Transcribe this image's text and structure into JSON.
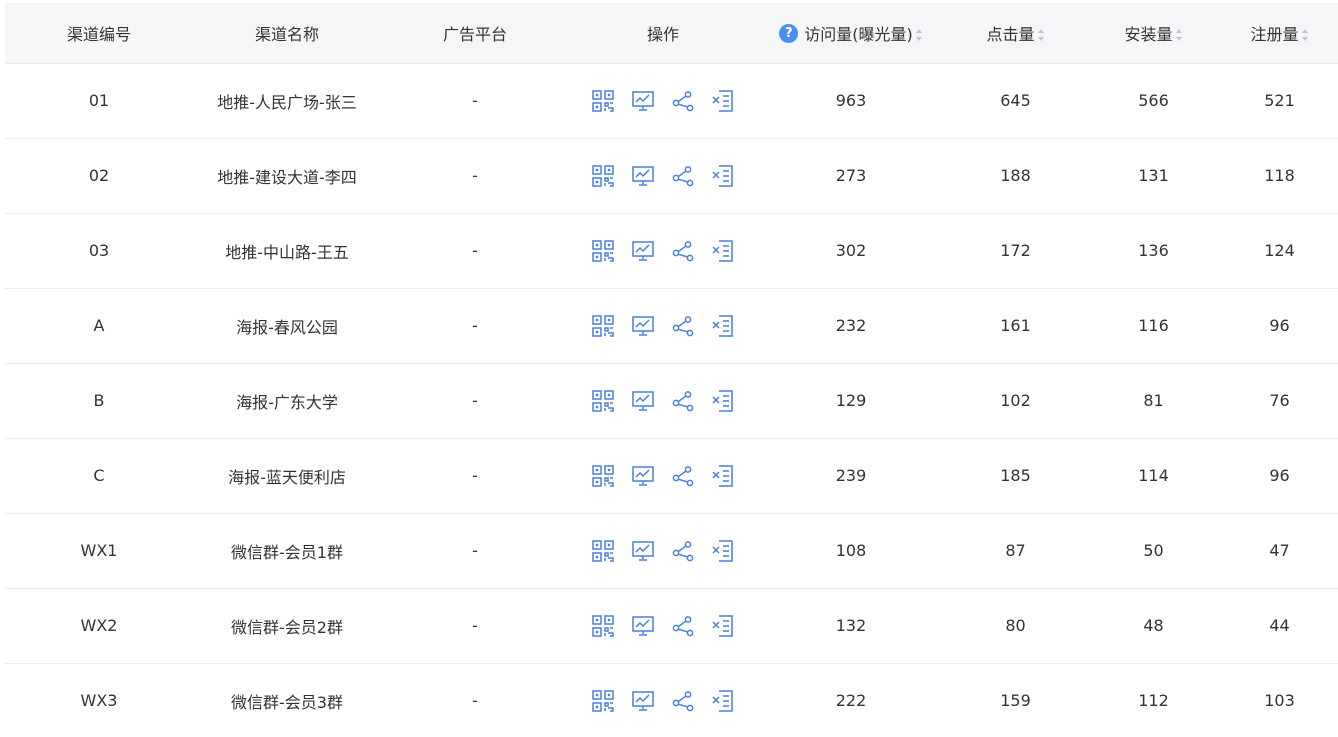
{
  "table": {
    "columns": [
      {
        "key": "code",
        "label": "渠道编号",
        "sortable": false,
        "help": false
      },
      {
        "key": "name",
        "label": "渠道名称",
        "sortable": false,
        "help": false
      },
      {
        "key": "platform",
        "label": "广告平台",
        "sortable": false,
        "help": false
      },
      {
        "key": "ops",
        "label": "操作",
        "sortable": false,
        "help": false
      },
      {
        "key": "visits",
        "label": "访问量(曝光量)",
        "sortable": true,
        "help": true
      },
      {
        "key": "clicks",
        "label": "点击量",
        "sortable": true,
        "help": false
      },
      {
        "key": "installs",
        "label": "安装量",
        "sortable": true,
        "help": false
      },
      {
        "key": "registers",
        "label": "注册量",
        "sortable": true,
        "help": false
      }
    ],
    "help_glyph": "?",
    "op_icons": [
      "qrcode-icon",
      "trend-chart-icon",
      "share-icon",
      "delete-list-icon"
    ],
    "rows": [
      {
        "code": "01",
        "name": "地推-人民广场-张三",
        "platform": "-",
        "visits": "963",
        "clicks": "645",
        "installs": "566",
        "registers": "521"
      },
      {
        "code": "02",
        "name": "地推-建设大道-李四",
        "platform": "-",
        "visits": "273",
        "clicks": "188",
        "installs": "131",
        "registers": "118"
      },
      {
        "code": "03",
        "name": "地推-中山路-王五",
        "platform": "-",
        "visits": "302",
        "clicks": "172",
        "installs": "136",
        "registers": "124"
      },
      {
        "code": "A",
        "name": "海报-春风公园",
        "platform": "-",
        "visits": "232",
        "clicks": "161",
        "installs": "116",
        "registers": "96"
      },
      {
        "code": "B",
        "name": "海报-广东大学",
        "platform": "-",
        "visits": "129",
        "clicks": "102",
        "installs": "81",
        "registers": "76"
      },
      {
        "code": "C",
        "name": "海报-蓝天便利店",
        "platform": "-",
        "visits": "239",
        "clicks": "185",
        "installs": "114",
        "registers": "96"
      },
      {
        "code": "WX1",
        "name": "微信群-会员1群",
        "platform": "-",
        "visits": "108",
        "clicks": "87",
        "installs": "50",
        "registers": "47"
      },
      {
        "code": "WX2",
        "name": "微信群-会员2群",
        "platform": "-",
        "visits": "132",
        "clicks": "80",
        "installs": "48",
        "registers": "44"
      },
      {
        "code": "WX3",
        "name": "微信群-会员3群",
        "platform": "-",
        "visits": "222",
        "clicks": "159",
        "installs": "112",
        "registers": "103"
      }
    ]
  },
  "colors": {
    "icon": "#4a7fdc",
    "header_bg": "#f5f6f8",
    "help_bg": "#4a8ef5"
  }
}
